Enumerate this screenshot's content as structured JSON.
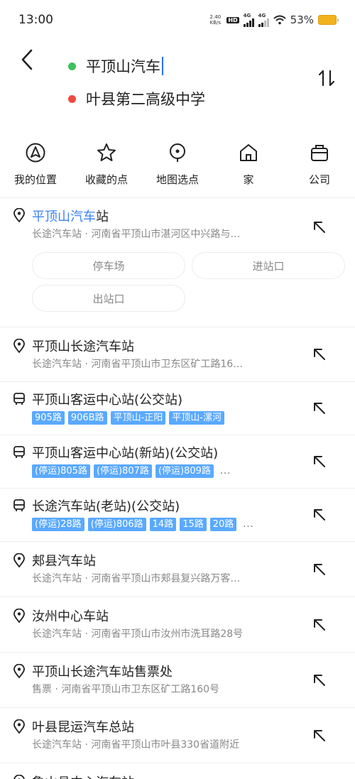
{
  "status_bar": {
    "time": "13:00",
    "net_speed_value": "2.40",
    "net_speed_unit": "KB/s",
    "hd_label": "HD",
    "sim1_label": "4G",
    "sim2_label": "4G",
    "battery_percent": "53%"
  },
  "route": {
    "from_text": "平顶山汽车",
    "to_text": "叶县第二高级中学"
  },
  "quick_actions": [
    {
      "label": "我的位置",
      "icon": "location-arrow-icon"
    },
    {
      "label": "收藏的点",
      "icon": "star-icon"
    },
    {
      "label": "地图选点",
      "icon": "map-pin-icon"
    },
    {
      "label": "家",
      "icon": "home-icon"
    },
    {
      "label": "公司",
      "icon": "briefcase-icon"
    }
  ],
  "results": [
    {
      "type": "place",
      "title_highlight": "平顶山汽车",
      "title_rest": "站",
      "subtitle": "长途汽车站 · 河南省平顶山市湛河区中兴路与…",
      "chips": [
        "停车场",
        "进站口",
        "出站口"
      ]
    },
    {
      "type": "place",
      "title": "平顶山长途汽车站",
      "subtitle": "长途汽车站 · 河南省平顶山市卫东区矿工路16…"
    },
    {
      "type": "bus",
      "title": "平顶山客运中心站(公交站)",
      "tags": [
        "905路",
        "906B路",
        "平顶山-正阳",
        "平顶山-漯河"
      ],
      "more": ""
    },
    {
      "type": "bus",
      "title": "平顶山客运中心站(新站)(公交站)",
      "tags": [
        "(停运)805路",
        "(停运)807路",
        "(停运)809路"
      ],
      "more": "..."
    },
    {
      "type": "bus",
      "title": "长途汽车站(老站)(公交站)",
      "tags": [
        "(停运)28路",
        "(停运)806路",
        "14路",
        "15路",
        "20路"
      ],
      "more": "..."
    },
    {
      "type": "place",
      "title": "郏县汽车站",
      "subtitle": "长途汽车站 · 河南省平顶山市郏县复兴路万客…"
    },
    {
      "type": "place",
      "title": "汝州中心车站",
      "subtitle": "长途汽车站 · 河南省平顶山市汝州市洗耳路28号"
    },
    {
      "type": "place",
      "title": "平顶山长途汽车站售票处",
      "subtitle": "售票 · 河南省平顶山市卫东区矿工路160号"
    },
    {
      "type": "place",
      "title": "叶县昆运汽车总站",
      "subtitle": "长途汽车站 · 河南省平顶山市叶县330省道附近"
    },
    {
      "type": "place",
      "title": "鲁山县中心汽车站",
      "subtitle": ""
    }
  ]
}
